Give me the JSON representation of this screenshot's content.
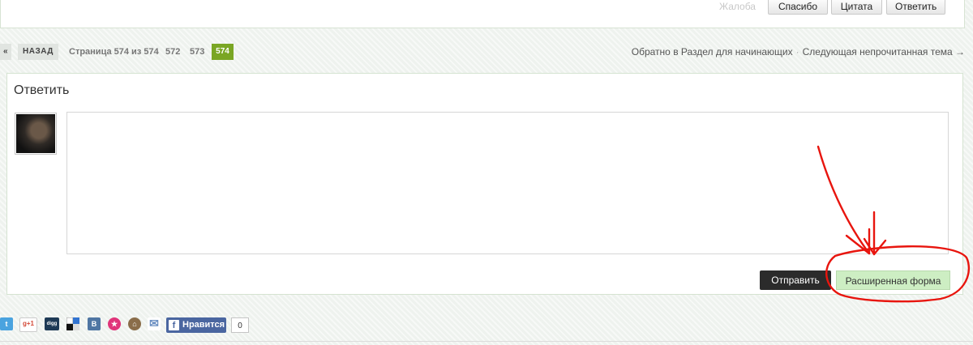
{
  "top_panel": {
    "complaint_label": "Жалоба",
    "buttons": {
      "thanks": "Спасибо",
      "quote": "Цитата",
      "reply": "Ответить"
    }
  },
  "pager": {
    "prev_arrow": "«",
    "back_label": "НАЗАД",
    "page_info": "Страница 574 из 574",
    "pages": [
      "572",
      "573"
    ],
    "current_page": "574",
    "back_to_section": "Обратно в Раздел для начинающих",
    "separator": "·",
    "next_unread": "Следующая непрочитанная тема →",
    "accent_color": "#7aa624"
  },
  "reply": {
    "title": "Ответить",
    "textarea_value": "",
    "send_label": "Отправить",
    "advanced_label": "Расширенная форма",
    "annotation_color": "#e8150e"
  },
  "share": {
    "icons": [
      "twitter-icon",
      "google-plus-icon",
      "digg-icon",
      "delicious-icon",
      "vkontakte-icon",
      "odnoklassniki-icon",
      "moikrug-icon",
      "email-icon"
    ],
    "gplus_text": "g+1",
    "digg_text": "digg",
    "vk_text": "B",
    "like_label": "Нравится",
    "like_count": "0"
  }
}
